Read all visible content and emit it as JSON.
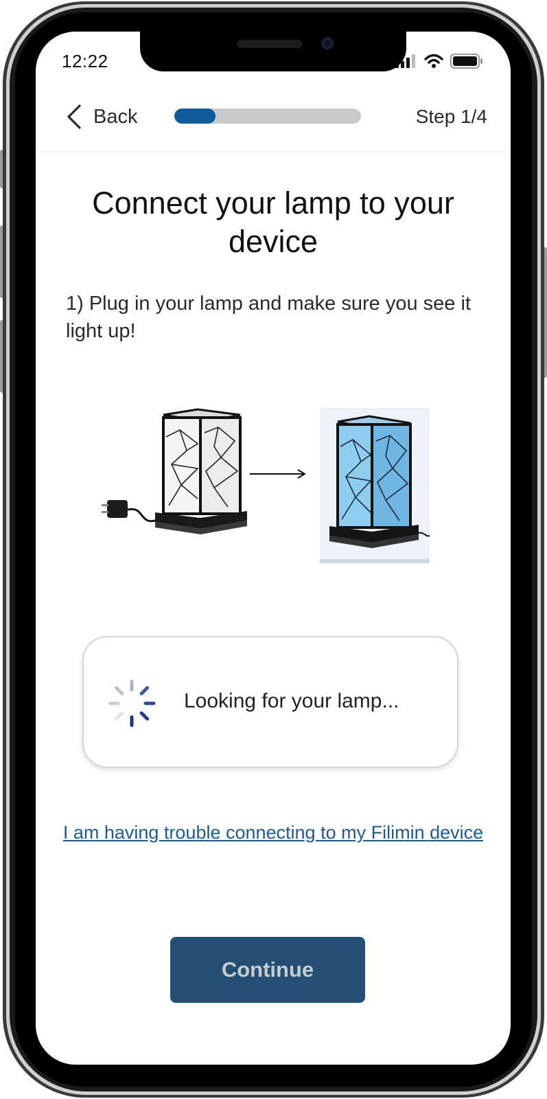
{
  "status_bar": {
    "time": "12:22"
  },
  "header": {
    "back_label": "Back",
    "step_label": "Step 1/4",
    "progress_fraction": 0.22
  },
  "content": {
    "title": "Connect your lamp to your device",
    "instruction": "1) Plug in your lamp and make sure you see it light up!",
    "search_status": "Looking for your lamp...",
    "help_link": "I am having trouble connecting to my Filimin device",
    "continue_label": "Continue"
  },
  "colors": {
    "accent": "#0e5a9a",
    "button": "#244f73",
    "link": "#1d5a92",
    "lamp_glow": "#7fc4ee"
  },
  "icons": {
    "back": "chevron-left-icon",
    "signal": "cellular-signal-icon",
    "wifi": "wifi-icon",
    "battery": "battery-icon",
    "spinner": "loading-spinner-icon",
    "arrow": "arrow-right-icon"
  }
}
